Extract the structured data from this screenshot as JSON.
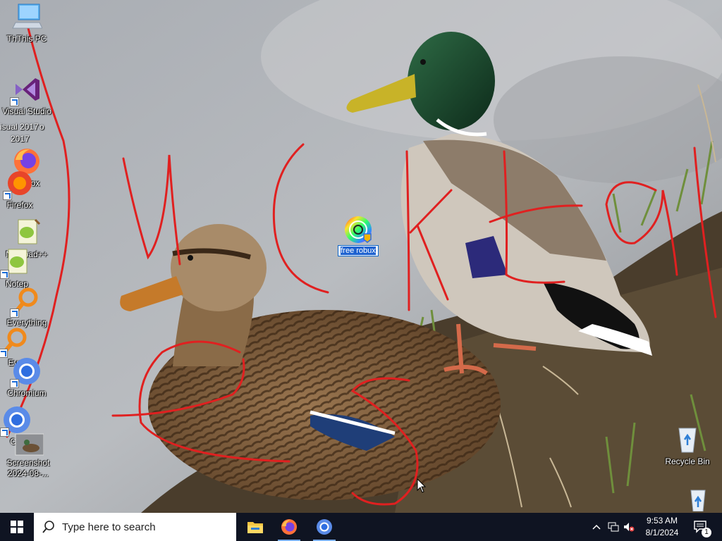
{
  "desktop": {
    "icons": [
      {
        "label": "This PC",
        "ghost": "ThThis PC"
      },
      {
        "label": "Visual Studio 2017",
        "ghost_a": "Visual Studio",
        "ghost_b": "isual 2017",
        "ghost_c": "2017",
        "ghost_d": "o"
      },
      {
        "label": "Firefox",
        "ghost": "Firefox"
      },
      {
        "label": "Notepad++",
        "ghost": "Notep"
      },
      {
        "label": "Everything",
        "ghost": "Eve"
      },
      {
        "label": "Chromium",
        "ghost": "Chr"
      },
      {
        "label": "Screenshot 2024-08-...",
        "line1": "Screenshot",
        "line2": "2024-08-..."
      },
      {
        "label": "Recycle Bin"
      }
    ],
    "selected_icon": {
      "label": "free robux",
      "state": "renaming"
    },
    "wallpaper_scribble_text": "UCK tul"
  },
  "taskbar": {
    "search_placeholder": "Type here to search",
    "pinned": [
      {
        "name": "File Explorer",
        "icon": "folder-icon"
      },
      {
        "name": "Firefox",
        "icon": "firefox-icon"
      },
      {
        "name": "Chromium",
        "icon": "chromium-icon"
      }
    ],
    "clock_time": "9:53 AM",
    "clock_date": "8/1/2024",
    "notification_count": "1"
  },
  "colors": {
    "taskbar": "#0f1422",
    "selection": "#1e62d0",
    "scribble": "#e02020"
  }
}
